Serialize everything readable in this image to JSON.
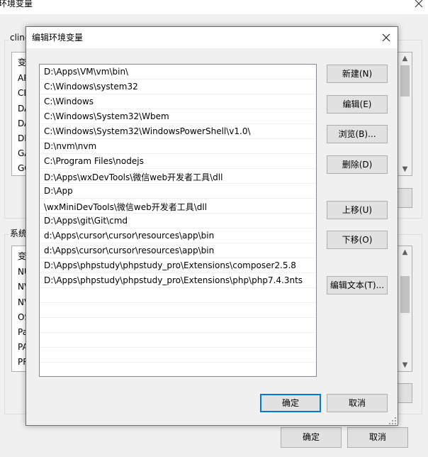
{
  "background_window": {
    "title": "环境变量",
    "user_group_label": "cling",
    "user_list": {
      "header_fragment": "变",
      "rows": [
        "AP",
        "CL",
        "DA",
        "DA",
        "DI",
        "GA",
        "GC"
      ]
    },
    "system_group_label": "系统",
    "system_list": {
      "header_fragment": "变",
      "rows": [
        "NU",
        "NV",
        "NV",
        "OS",
        "Pa",
        "PA",
        "PR"
      ]
    },
    "ok_label": "确定",
    "cancel_label": "取消"
  },
  "dialog": {
    "title": "编辑环境变量",
    "paths": [
      "D:\\Apps\\VM\\vm\\bin\\",
      "C:\\Windows\\system32",
      "C:\\Windows",
      "C:\\Windows\\System32\\Wbem",
      "C:\\Windows\\System32\\WindowsPowerShell\\v1.0\\",
      "D:\\nvm\\nvm",
      "C:\\Program Files\\nodejs",
      "D:\\Apps\\wxDevTools\\微信web开发者工具\\dll",
      "D:\\App",
      "\\wxMiniDevTools\\微信web开发者工具\\dll",
      "D:\\Apps\\git\\Git\\cmd",
      "d:\\Apps\\cursor\\cursor\\resources\\app\\bin",
      "d:\\Apps\\cursor\\cursor\\resources\\app\\bin",
      "D:\\Apps\\phpstudy\\phpstudy_pro\\Extensions\\composer2.5.8",
      "D:\\Apps\\phpstudy\\phpstudy_pro\\Extensions\\php\\php7.4.3nts"
    ],
    "buttons": {
      "new": "新建(N)",
      "edit": "编辑(E)",
      "browse": "浏览(B)...",
      "delete": "删除(D)",
      "move_up": "上移(U)",
      "move_down": "下移(O)",
      "edit_text": "编辑文本(T)...",
      "ok": "确定",
      "cancel": "取消"
    }
  },
  "colors": {
    "accent": "#0078d7",
    "button_face": "#e1e1e1",
    "window_bg": "#f0f0f0"
  }
}
